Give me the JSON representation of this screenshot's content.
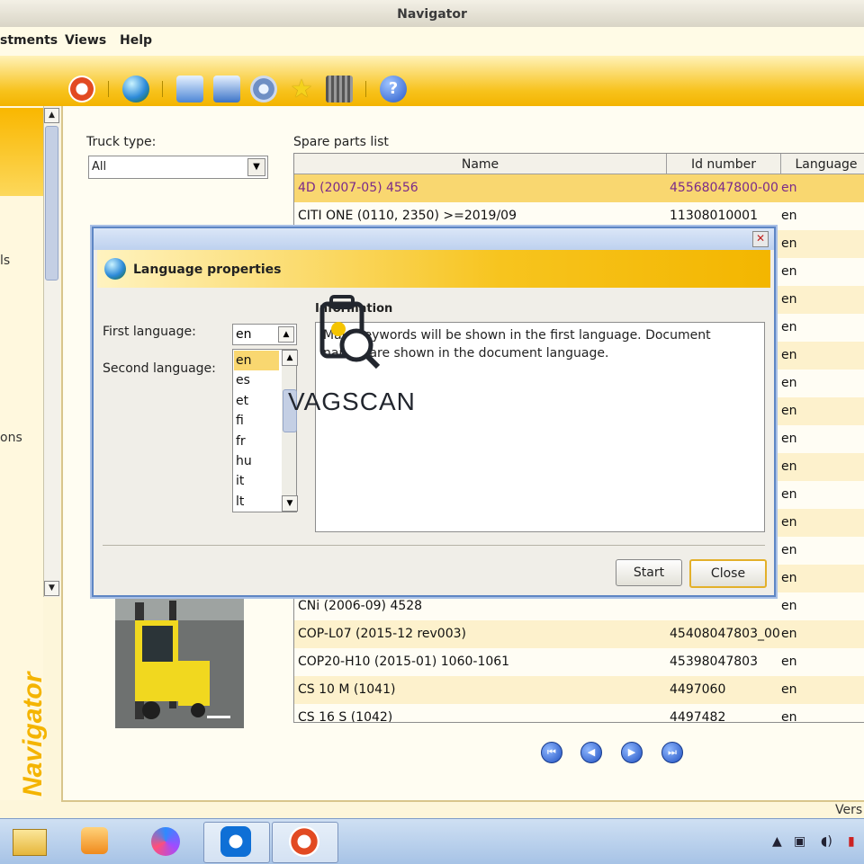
{
  "window": {
    "title": "Navigator"
  },
  "menu": {
    "items": [
      "stments",
      "Views",
      "Help"
    ]
  },
  "toolbar": {
    "icons": [
      "lifebuoy-icon",
      "globe-icon",
      "catalog-icon",
      "search-catalog-icon",
      "settings-gear-icon",
      "favorites-star-icon",
      "film-icon",
      "help-icon"
    ]
  },
  "sidebar": {
    "labels": [
      "ls",
      "ons"
    ]
  },
  "brand": {
    "vertical_text": "Navigator"
  },
  "truck_type": {
    "label": "Truck type:",
    "value": "All"
  },
  "spare_parts": {
    "label": "Spare parts list",
    "columns": [
      "Name",
      "Id number",
      "Language"
    ],
    "rows": [
      {
        "name": "4D (2007-05) 4556",
        "id": "45568047800-00",
        "lang": "en"
      },
      {
        "name": "CITI ONE (0110, 2350) >=2019/09",
        "id": "11308010001",
        "lang": "en"
      },
      {
        "name": "",
        "id": "",
        "lang": "en"
      },
      {
        "name": "",
        "id": "",
        "lang": "en"
      },
      {
        "name": "",
        "id": "",
        "lang": "en"
      },
      {
        "name": "",
        "id": "",
        "lang": "en"
      },
      {
        "name": "",
        "id": "",
        "lang": "en"
      },
      {
        "name": "",
        "id": "",
        "lang": "en"
      },
      {
        "name": "",
        "id": "",
        "lang": "en"
      },
      {
        "name": "",
        "id": "",
        "lang": "en"
      },
      {
        "name": "",
        "id": "",
        "lang": "en"
      },
      {
        "name": "",
        "id": "",
        "lang": "en"
      },
      {
        "name": "",
        "id": "",
        "lang": "en"
      },
      {
        "name": "",
        "id": "",
        "lang": "en"
      },
      {
        "name": "",
        "id": "",
        "lang": "en"
      },
      {
        "name": "CNi (2006-09) 4528",
        "id": "",
        "lang": "en"
      },
      {
        "name": "COP-L07 (2015-12 rev003)",
        "id": "45408047803_00",
        "lang": "en"
      },
      {
        "name": "COP20-H10 (2015-01) 1060-1061",
        "id": "45398047803",
        "lang": "en"
      },
      {
        "name": "CS 10 M (1041)",
        "id": "4497060",
        "lang": "en"
      },
      {
        "name": "CS 16 S (1042)",
        "id": "4497482",
        "lang": "en"
      }
    ]
  },
  "pager": {
    "icons": [
      "first-page-icon",
      "prev-page-icon",
      "next-page-icon",
      "last-page-icon"
    ]
  },
  "status": {
    "version_text": "Vers"
  },
  "dialog": {
    "title": "Language properties",
    "first_language_label": "First language:",
    "first_language_value": "en",
    "second_language_label": "Second language:",
    "language_options": [
      "en",
      "es",
      "et",
      "fi",
      "fr",
      "hu",
      "it",
      "lt"
    ],
    "selected_option": "en",
    "info_label": "Information",
    "info_text": "Main keywords will be shown in the first language. Document names are shown in the document language.",
    "start_label": "Start",
    "close_label": "Close"
  },
  "watermark": {
    "text": "VAGSCAN"
  },
  "taskbar": {
    "tasks": [
      "file-explorer-icon",
      "media-player-icon",
      "app-icon",
      "teamviewer-icon",
      "navigator-app-icon"
    ]
  }
}
